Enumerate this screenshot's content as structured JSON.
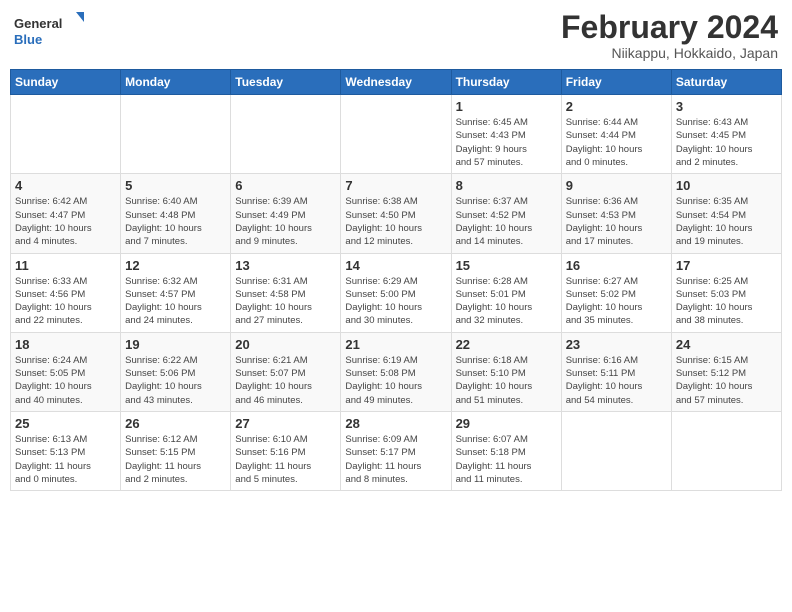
{
  "header": {
    "logo_general": "General",
    "logo_blue": "Blue",
    "month": "February 2024",
    "location": "Niikappu, Hokkaido, Japan"
  },
  "weekdays": [
    "Sunday",
    "Monday",
    "Tuesday",
    "Wednesday",
    "Thursday",
    "Friday",
    "Saturday"
  ],
  "weeks": [
    [
      {
        "day": "",
        "info": ""
      },
      {
        "day": "",
        "info": ""
      },
      {
        "day": "",
        "info": ""
      },
      {
        "day": "",
        "info": ""
      },
      {
        "day": "1",
        "info": "Sunrise: 6:45 AM\nSunset: 4:43 PM\nDaylight: 9 hours\nand 57 minutes."
      },
      {
        "day": "2",
        "info": "Sunrise: 6:44 AM\nSunset: 4:44 PM\nDaylight: 10 hours\nand 0 minutes."
      },
      {
        "day": "3",
        "info": "Sunrise: 6:43 AM\nSunset: 4:45 PM\nDaylight: 10 hours\nand 2 minutes."
      }
    ],
    [
      {
        "day": "4",
        "info": "Sunrise: 6:42 AM\nSunset: 4:47 PM\nDaylight: 10 hours\nand 4 minutes."
      },
      {
        "day": "5",
        "info": "Sunrise: 6:40 AM\nSunset: 4:48 PM\nDaylight: 10 hours\nand 7 minutes."
      },
      {
        "day": "6",
        "info": "Sunrise: 6:39 AM\nSunset: 4:49 PM\nDaylight: 10 hours\nand 9 minutes."
      },
      {
        "day": "7",
        "info": "Sunrise: 6:38 AM\nSunset: 4:50 PM\nDaylight: 10 hours\nand 12 minutes."
      },
      {
        "day": "8",
        "info": "Sunrise: 6:37 AM\nSunset: 4:52 PM\nDaylight: 10 hours\nand 14 minutes."
      },
      {
        "day": "9",
        "info": "Sunrise: 6:36 AM\nSunset: 4:53 PM\nDaylight: 10 hours\nand 17 minutes."
      },
      {
        "day": "10",
        "info": "Sunrise: 6:35 AM\nSunset: 4:54 PM\nDaylight: 10 hours\nand 19 minutes."
      }
    ],
    [
      {
        "day": "11",
        "info": "Sunrise: 6:33 AM\nSunset: 4:56 PM\nDaylight: 10 hours\nand 22 minutes."
      },
      {
        "day": "12",
        "info": "Sunrise: 6:32 AM\nSunset: 4:57 PM\nDaylight: 10 hours\nand 24 minutes."
      },
      {
        "day": "13",
        "info": "Sunrise: 6:31 AM\nSunset: 4:58 PM\nDaylight: 10 hours\nand 27 minutes."
      },
      {
        "day": "14",
        "info": "Sunrise: 6:29 AM\nSunset: 5:00 PM\nDaylight: 10 hours\nand 30 minutes."
      },
      {
        "day": "15",
        "info": "Sunrise: 6:28 AM\nSunset: 5:01 PM\nDaylight: 10 hours\nand 32 minutes."
      },
      {
        "day": "16",
        "info": "Sunrise: 6:27 AM\nSunset: 5:02 PM\nDaylight: 10 hours\nand 35 minutes."
      },
      {
        "day": "17",
        "info": "Sunrise: 6:25 AM\nSunset: 5:03 PM\nDaylight: 10 hours\nand 38 minutes."
      }
    ],
    [
      {
        "day": "18",
        "info": "Sunrise: 6:24 AM\nSunset: 5:05 PM\nDaylight: 10 hours\nand 40 minutes."
      },
      {
        "day": "19",
        "info": "Sunrise: 6:22 AM\nSunset: 5:06 PM\nDaylight: 10 hours\nand 43 minutes."
      },
      {
        "day": "20",
        "info": "Sunrise: 6:21 AM\nSunset: 5:07 PM\nDaylight: 10 hours\nand 46 minutes."
      },
      {
        "day": "21",
        "info": "Sunrise: 6:19 AM\nSunset: 5:08 PM\nDaylight: 10 hours\nand 49 minutes."
      },
      {
        "day": "22",
        "info": "Sunrise: 6:18 AM\nSunset: 5:10 PM\nDaylight: 10 hours\nand 51 minutes."
      },
      {
        "day": "23",
        "info": "Sunrise: 6:16 AM\nSunset: 5:11 PM\nDaylight: 10 hours\nand 54 minutes."
      },
      {
        "day": "24",
        "info": "Sunrise: 6:15 AM\nSunset: 5:12 PM\nDaylight: 10 hours\nand 57 minutes."
      }
    ],
    [
      {
        "day": "25",
        "info": "Sunrise: 6:13 AM\nSunset: 5:13 PM\nDaylight: 11 hours\nand 0 minutes."
      },
      {
        "day": "26",
        "info": "Sunrise: 6:12 AM\nSunset: 5:15 PM\nDaylight: 11 hours\nand 2 minutes."
      },
      {
        "day": "27",
        "info": "Sunrise: 6:10 AM\nSunset: 5:16 PM\nDaylight: 11 hours\nand 5 minutes."
      },
      {
        "day": "28",
        "info": "Sunrise: 6:09 AM\nSunset: 5:17 PM\nDaylight: 11 hours\nand 8 minutes."
      },
      {
        "day": "29",
        "info": "Sunrise: 6:07 AM\nSunset: 5:18 PM\nDaylight: 11 hours\nand 11 minutes."
      },
      {
        "day": "",
        "info": ""
      },
      {
        "day": "",
        "info": ""
      }
    ]
  ]
}
